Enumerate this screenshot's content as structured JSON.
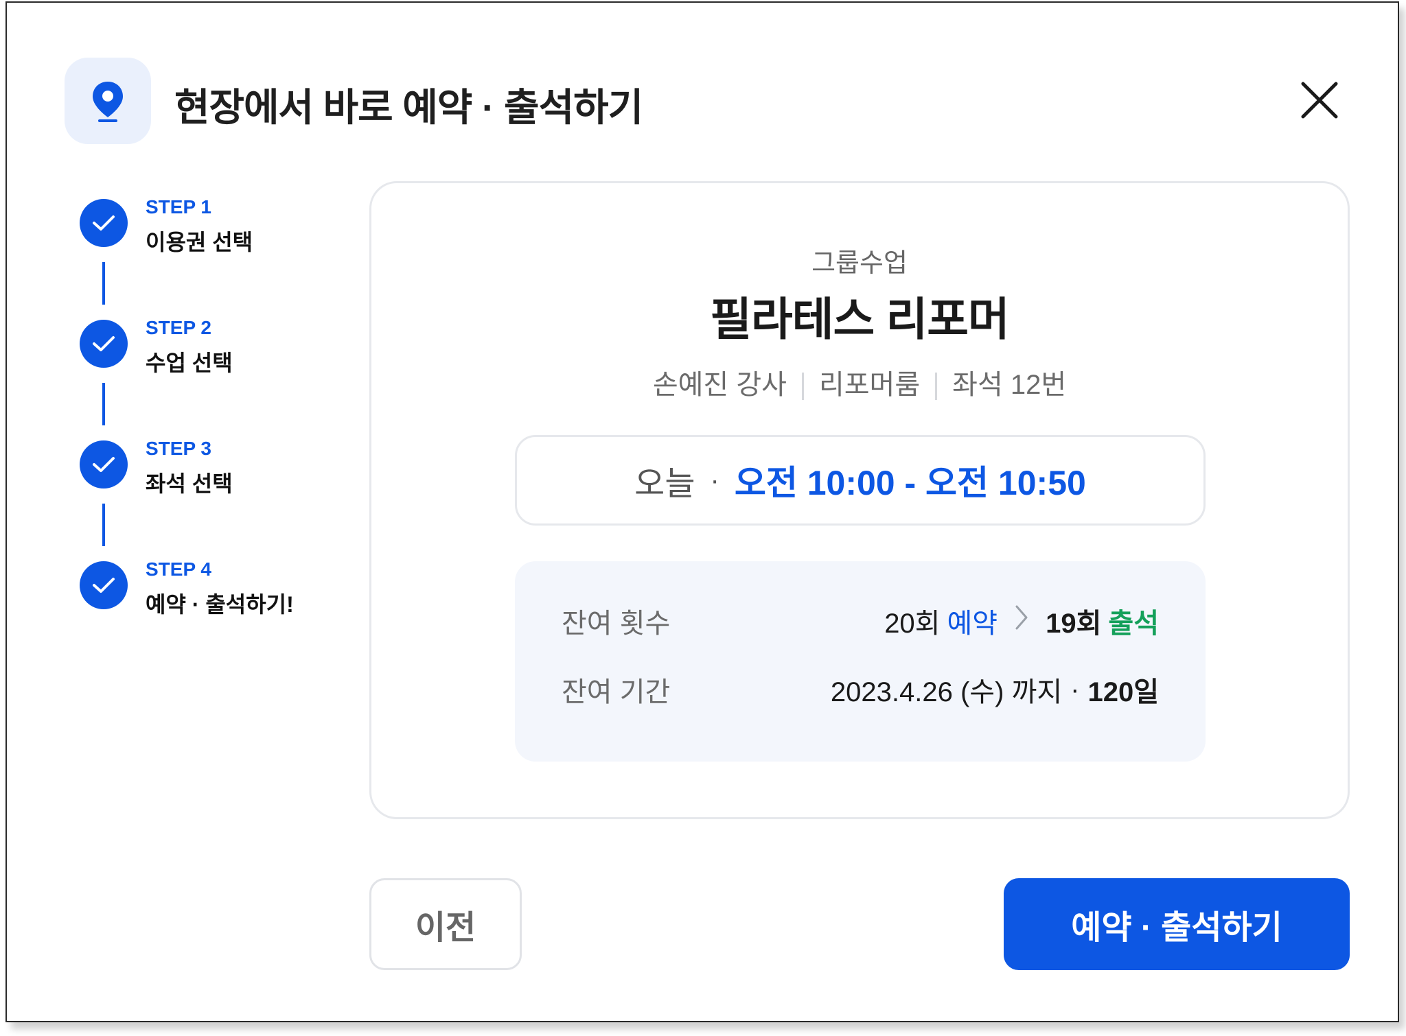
{
  "header": {
    "title": "현장에서 바로 예약 · 출석하기",
    "icon": "location-pin-icon",
    "close_icon": "close-icon"
  },
  "steps": [
    {
      "step": "STEP 1",
      "label": "이용권 선택",
      "completed": true
    },
    {
      "step": "STEP 2",
      "label": "수업 선택",
      "completed": true
    },
    {
      "step": "STEP 3",
      "label": "좌석 선택",
      "completed": true
    },
    {
      "step": "STEP 4",
      "label": "예약 · 출석하기!",
      "completed": true
    }
  ],
  "class_card": {
    "type": "그룹수업",
    "name": "필라테스 리포머",
    "instructor": "손예진 강사",
    "room": "리포머룸",
    "seat": "좌석 12번",
    "time": {
      "day": "오늘",
      "dot": "·",
      "range": "오전 10:00 - 오전 10:50"
    },
    "remaining_count": {
      "label": "잔여 횟수",
      "before_count": "20회",
      "before_word": "예약",
      "after_count": "19회",
      "after_word": "출석"
    },
    "remaining_period": {
      "label": "잔여 기간",
      "until": "2023.4.26 (수) 까지",
      "dot": "·",
      "days": "120일"
    }
  },
  "buttons": {
    "prev_label": "이전",
    "confirm_label": "예약 · 출석하기"
  },
  "colors": {
    "accent": "#0d57e3",
    "success": "#14a05a",
    "icon_bg": "#eaf0fc",
    "info_bg": "#f3f6fc"
  }
}
